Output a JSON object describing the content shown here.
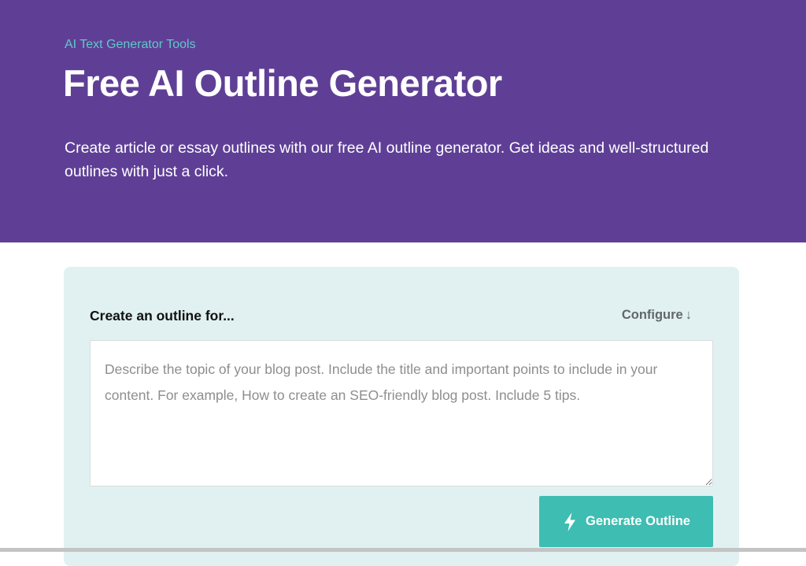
{
  "hero": {
    "breadcrumb": "AI Text Generator Tools",
    "title": "Free AI Outline Generator",
    "subtitle": "Create article or essay outlines with our free AI outline generator. Get ideas and well-structured outlines with just a click.",
    "background_color": "#5f3f96",
    "breadcrumb_color": "#5ec9c6"
  },
  "form": {
    "label": "Create an outline for...",
    "configure_label": "Configure",
    "configure_icon": "arrow-down-icon",
    "configure_arrow": "↓",
    "input_value": "",
    "input_placeholder": "Describe the topic of your blog post. Include the title and important points to include in your content. For example, How to create an SEO-friendly blog post. Include 5 tips.",
    "generate_label": "Generate Outline",
    "generate_icon": "lightning-bolt-icon",
    "card_color": "#e1f1f1",
    "button_color": "#3ebdb2"
  }
}
